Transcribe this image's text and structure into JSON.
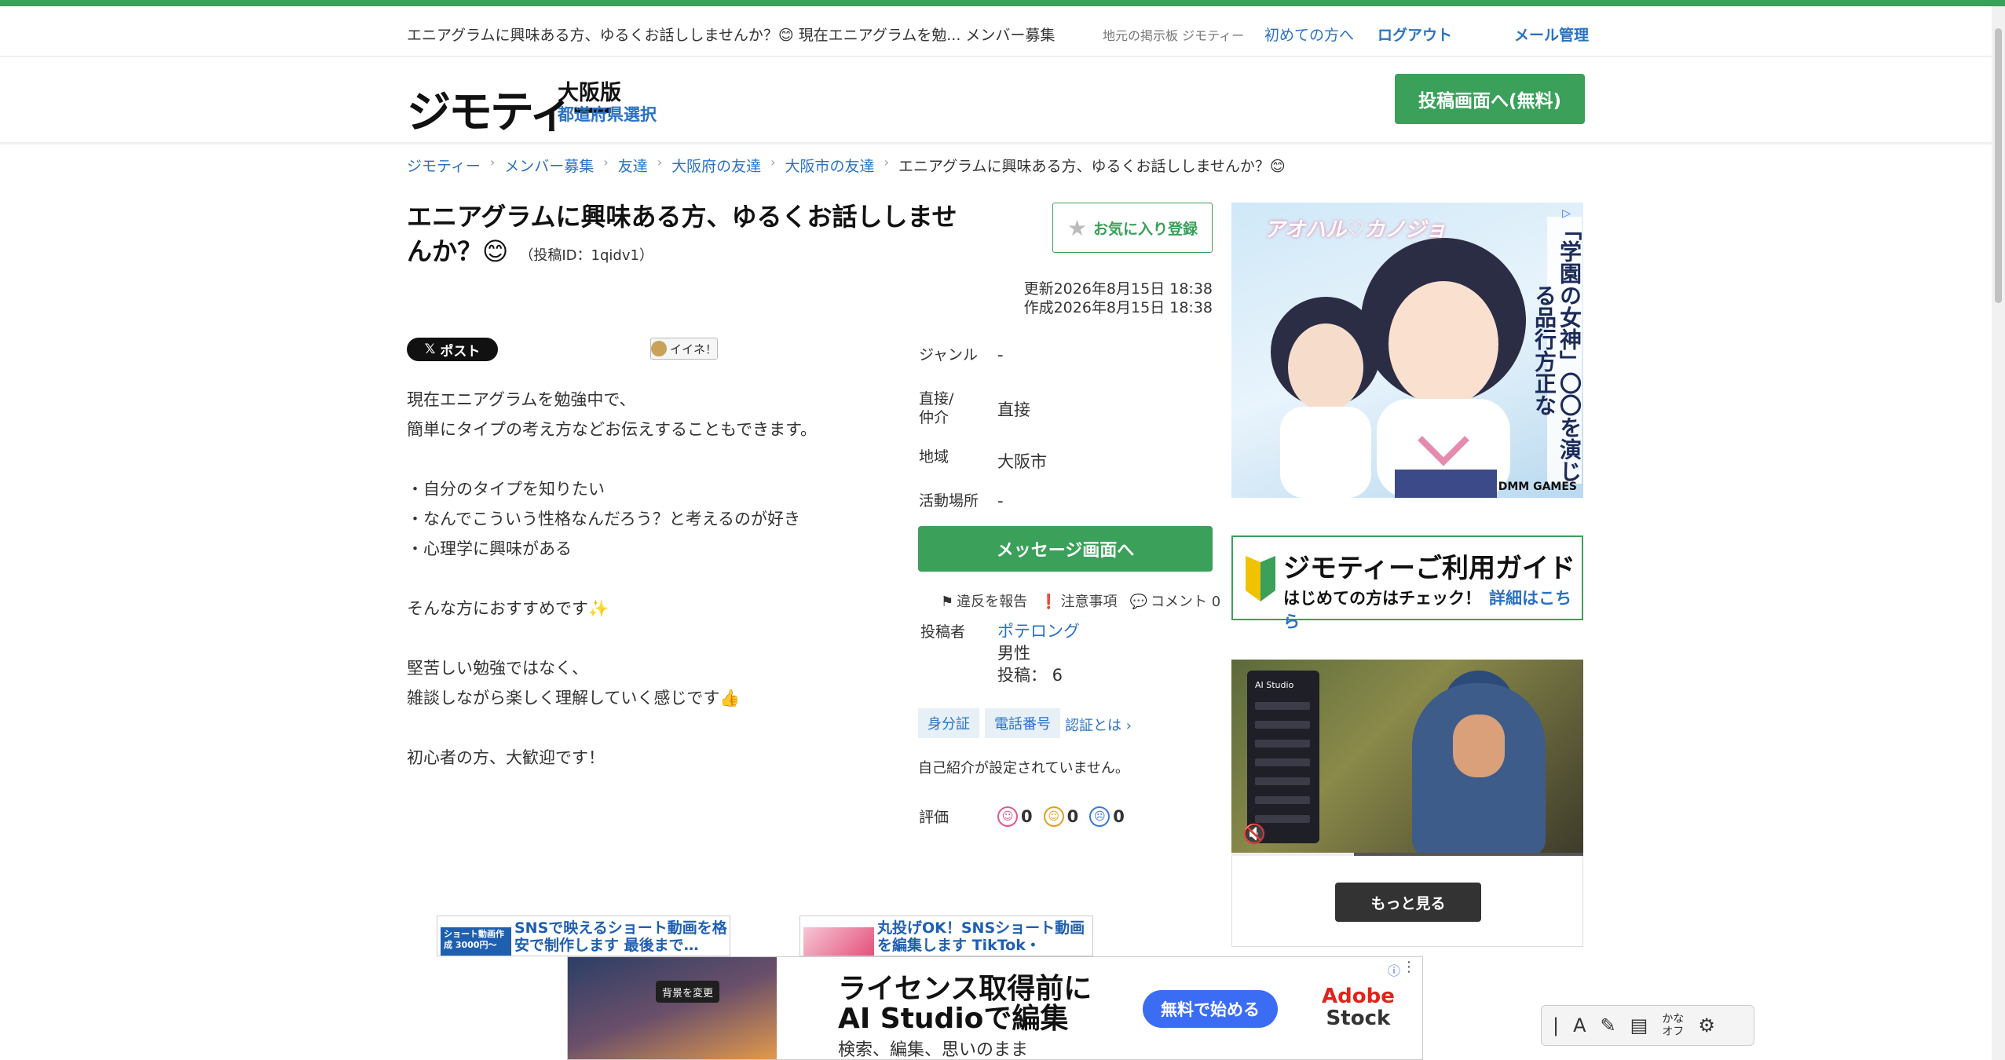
{
  "topbar": {
    "title": "エニアグラムに興味ある方、ゆるくお話ししませんか？😊 現在エニアグラムを勉... メンバー募集",
    "tagline": "地元の掲示板 ジモティー",
    "first_time": "初めての方へ",
    "logout": "ログアウト",
    "mail": "メール管理"
  },
  "header": {
    "logo": "ジモティー",
    "prefecture": "大阪版",
    "prefecture_select": "都道府県選択",
    "post_button": "投稿画面へ(無料)"
  },
  "breadcrumb": [
    "ジモティー",
    "メンバー募集",
    "友達",
    "大阪府の友達",
    "大阪市の友達",
    "エニアグラムに興味ある方、ゆるくお話ししませんか？😊"
  ],
  "post": {
    "title": "エニアグラムに興味ある方、ゆるくお話ししませんか？😊",
    "post_id": "（投稿ID：1qidv1）",
    "favorite_button": "お気に入り登録",
    "updated": "更新2026年8月15日 18:38",
    "created": "作成2026年8月15日 18:38",
    "x_post": "ポスト",
    "iine": "イイネ！",
    "body": "現在エニアグラムを勉強中で、\n簡単にタイプの考え方などお伝えすることもできます。\n\n・自分のタイプを知りたい\n・なんでこういう性格なんだろう？と考えるのが好き\n・心理学に興味がある\n\nそんな方におすすめです✨\n\n堅苦しい勉強ではなく、\n雑談しながら楽しく理解していく感じです👍\n\n初心者の方、大歓迎です！"
  },
  "info": {
    "genre_label": "ジャンル",
    "genre_value": "-",
    "direct_label1": "直接/",
    "direct_label2": "仲介",
    "direct_value": "直接",
    "area_label": "地域",
    "area_value": "大阪市",
    "place_label": "活動場所",
    "place_value": "-",
    "message_button": "メッセージ画面へ",
    "report": "違反を報告",
    "caution": "注意事項",
    "comment": "コメント 0",
    "poster_label": "投稿者",
    "poster_name": "ポテロング",
    "poster_gender": "男性",
    "poster_posts": "投稿： 6",
    "badge_id": "身分証",
    "badge_phone": "電話番号",
    "verify_link": "認証とは ›",
    "intro": "自己紹介が設定されていません。",
    "rating_label": "評価",
    "rating_good": "0",
    "rating_normal": "0",
    "rating_bad": "0"
  },
  "ads": {
    "ad1_brand": "アオハル♡カノジョ",
    "ad1_vert": "「学園の女神」〇〇を演じる品行方正な",
    "ad1_maker": "DMM GAMES",
    "guide_title": "ジモティーご利用ガイド",
    "guide_sub": "はじめての方はチェック！",
    "guide_link": "詳細はこちら",
    "video_panel": "AI Studio",
    "more_button": "もっと見る",
    "mini1_thumb": "ショート動画作成 3000円〜",
    "mini1_text": "SNSで映えるショート動画を格安で制作します 最後まで…",
    "mini2_text": "丸投げOK！SNSショート動画を編集します TikTok・Insta…",
    "bottom_chip": "背景を変更",
    "bottom_h1a": "ライセンス取得前に",
    "bottom_h1b": "AI Studioで編集",
    "bottom_h2": "検索、編集、思いのまま",
    "bottom_cta": "無料で始める",
    "bottom_brand1": "Adobe",
    "bottom_brand2": "Stock"
  },
  "ime": {
    "kana_top": "かな",
    "kana_bottom": "オフ"
  },
  "colors": {
    "primary_green": "#3aa05a",
    "link_blue": "#2a72c4"
  }
}
